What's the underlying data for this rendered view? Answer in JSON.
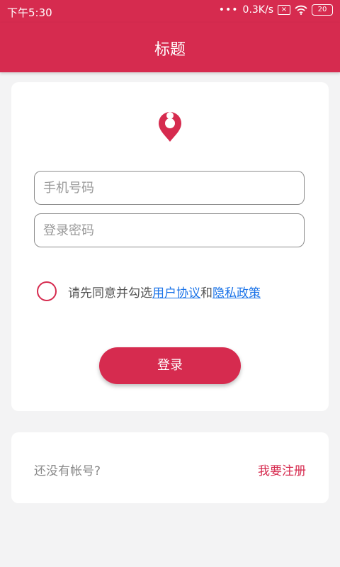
{
  "status_bar": {
    "time": "下午5:30",
    "dots": "•••",
    "speed": "0.3K/s",
    "sim_badge": "×",
    "battery": "20"
  },
  "header": {
    "title": "标题"
  },
  "login": {
    "phone_placeholder": "手机号码",
    "password_placeholder": "登录密码",
    "agree_prefix": "请先同意并勾选",
    "user_agreement": "用户协议",
    "and_text": "和",
    "privacy_policy": "隐私政策",
    "login_button": "登录"
  },
  "register": {
    "no_account": "还没有帐号?",
    "register_link": "我要注册"
  },
  "colors": {
    "brand": "#d62b4f",
    "link": "#1a73e8",
    "background": "#f3f3f4"
  },
  "icons": {
    "logo": "location-pin-person-icon",
    "wifi": "wifi-icon"
  }
}
